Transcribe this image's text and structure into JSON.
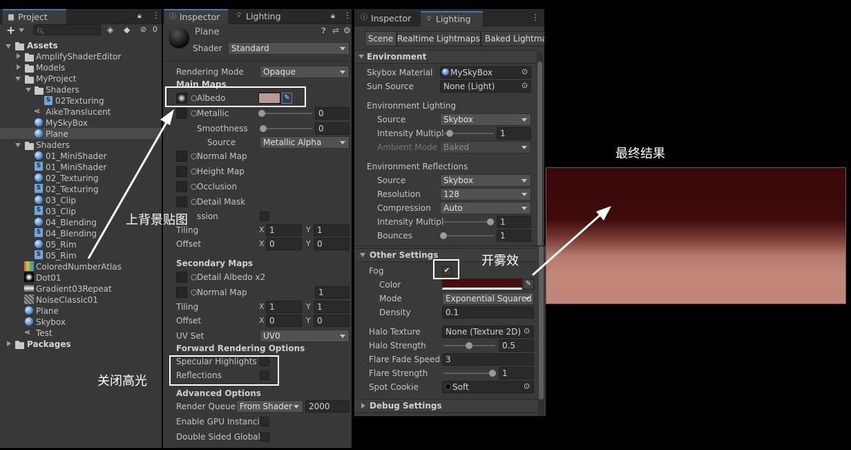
{
  "project": {
    "tab": "Project",
    "header_count": "0",
    "search_placeholder": "",
    "assets_label": "Assets",
    "items": [
      {
        "label": "AmplifyShaderEditor"
      },
      {
        "label": "Models"
      },
      {
        "label": "MyProject"
      },
      {
        "label": "Shaders"
      },
      {
        "label": "02Texturing"
      },
      {
        "label": "AikeTranslucent"
      },
      {
        "label": "MySkyBox"
      },
      {
        "label": "Plane"
      },
      {
        "label": "Shaders"
      },
      {
        "label": "01_MiniShader"
      },
      {
        "label": "01_MiniShader"
      },
      {
        "label": "02_Texturing"
      },
      {
        "label": "02_Texturing"
      },
      {
        "label": "03_Clip"
      },
      {
        "label": "03_Clip"
      },
      {
        "label": "04_Blending"
      },
      {
        "label": "04_Blending"
      },
      {
        "label": "05_Rim"
      },
      {
        "label": "05_Rim"
      },
      {
        "label": "ColoredNumberAtlas"
      },
      {
        "label": "Dot01"
      },
      {
        "label": "Gradient03Repeat"
      },
      {
        "label": "NoiseClassic01"
      },
      {
        "label": "Plane"
      },
      {
        "label": "Skybox"
      },
      {
        "label": "Test"
      }
    ],
    "packages_label": "Packages"
  },
  "inspector": {
    "tab_inspector": "Inspector",
    "tab_lighting": "Lighting",
    "material_name": "Plane",
    "shader_label": "Shader",
    "shader_value": "Standard",
    "rendering_mode_label": "Rendering Mode",
    "rendering_mode_value": "Opaque",
    "main_maps": "Main Maps",
    "albedo": "Albedo",
    "metallic": "Metallic",
    "metallic_value": "0",
    "smoothness": "Smoothness",
    "smoothness_value": "0",
    "source": "Source",
    "source_value": "Metallic Alpha",
    "normal_map": "Normal Map",
    "height_map": "Height Map",
    "occlusion": "Occlusion",
    "detail_mask": "Detail Mask",
    "emission": "ssion",
    "tiling": "Tiling",
    "offset": "Offset",
    "x": "X",
    "y": "Y",
    "tiling_x": "1",
    "tiling_y": "1",
    "offset_x": "0",
    "offset_y": "0",
    "secondary_maps": "Secondary Maps",
    "detail_albedo": "Detail Albedo x2",
    "normal_map2": "Normal Map",
    "normal_map2_value": "1",
    "tiling2_x": "1",
    "tiling2_y": "1",
    "offset2_x": "0",
    "offset2_y": "0",
    "uv_set": "UV Set",
    "uv_set_value": "UV0",
    "forward_options": "Forward Rendering Options",
    "specular": "Specular Highlights",
    "reflections": "Reflections",
    "advanced": "Advanced Options",
    "render_queue": "Render Queue",
    "render_queue_mode": "From Shader",
    "render_queue_value": "2000",
    "gpu_instancing": "Enable GPU Instancin",
    "double_sided": "Double Sided Global I"
  },
  "lighting": {
    "tab_inspector": "Inspector",
    "tab_lighting": "Lighting",
    "subtab_scene": "Scene",
    "subtab_realtime": "Realtime Lightmaps",
    "subtab_baked": "Baked Lightma",
    "environment": "Environment",
    "skybox_material": "Skybox Material",
    "skybox_material_value": "MySkyBox",
    "sun_source": "Sun Source",
    "sun_source_value": "None (Light)",
    "env_lighting": "Environment Lighting",
    "source": "Source",
    "source_value": "Skybox",
    "intensity": "Intensity Multipl",
    "intensity_value": "1",
    "ambient_mode": "Ambient Mode",
    "ambient_mode_value": "Baked",
    "env_reflections": "Environment Reflections",
    "refl_source_value": "Skybox",
    "resolution": "Resolution",
    "resolution_value": "128",
    "compression": "Compression",
    "compression_value": "Auto",
    "refl_intensity_value": "1",
    "bounces": "Bounces",
    "bounces_value": "1",
    "other_settings": "Other Settings",
    "fog": "Fog",
    "color": "Color",
    "mode": "Mode",
    "mode_value": "Exponential Squared",
    "density": "Density",
    "density_value": "0.1",
    "halo_texture": "Halo Texture",
    "halo_texture_value": "None (Texture 2D)",
    "halo_strength": "Halo Strength",
    "halo_strength_value": "0.5",
    "flare_fade": "Flare Fade Speed",
    "flare_fade_value": "3",
    "flare_strength": "Flare Strength",
    "flare_strength_value": "1",
    "spot_cookie": "Spot Cookie",
    "spot_cookie_value": "Soft",
    "debug_settings": "Debug Settings"
  },
  "annotations": {
    "background_texture": "上背景贴图",
    "close_highlight": "关闭高光",
    "enable_fog": "开雾效",
    "final_result": "最终结果"
  },
  "colors": {
    "fog_color": "#4a0c0c",
    "albedo_color": "#b89b99",
    "result_top": "#3b0809",
    "result_bottom": "#c3877a"
  }
}
